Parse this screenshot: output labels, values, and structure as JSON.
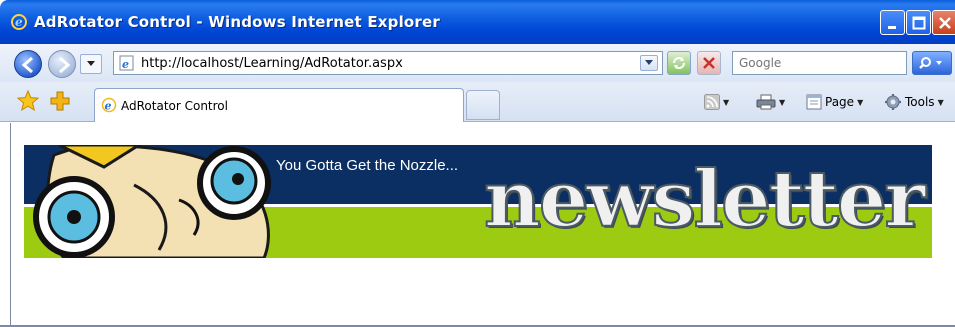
{
  "window": {
    "title": "AdRotator Control - Windows Internet Explorer"
  },
  "address_bar": {
    "url": "http://localhost/Learning/AdRotator.aspx"
  },
  "search": {
    "placeholder": "Google"
  },
  "tab": {
    "label": "AdRotator Control"
  },
  "commands": {
    "page_label": "Page",
    "tools_label": "Tools"
  },
  "banner": {
    "tagline": "You Gotta Get the Nozzle...",
    "brand_text": "newsletter",
    "colors": {
      "navy": "#0c2f63",
      "green": "#9ccb12"
    }
  },
  "icons": {
    "app": "ie-icon",
    "back": "back-arrow-icon",
    "forward": "forward-arrow-icon",
    "refresh": "refresh-icon",
    "stop": "stop-icon",
    "search": "search-icon",
    "favorites": "favorites-star-icon",
    "add_favorites": "add-favorites-icon",
    "feeds": "rss-feed-icon",
    "print": "printer-icon",
    "page": "page-icon",
    "tools": "gear-icon"
  }
}
